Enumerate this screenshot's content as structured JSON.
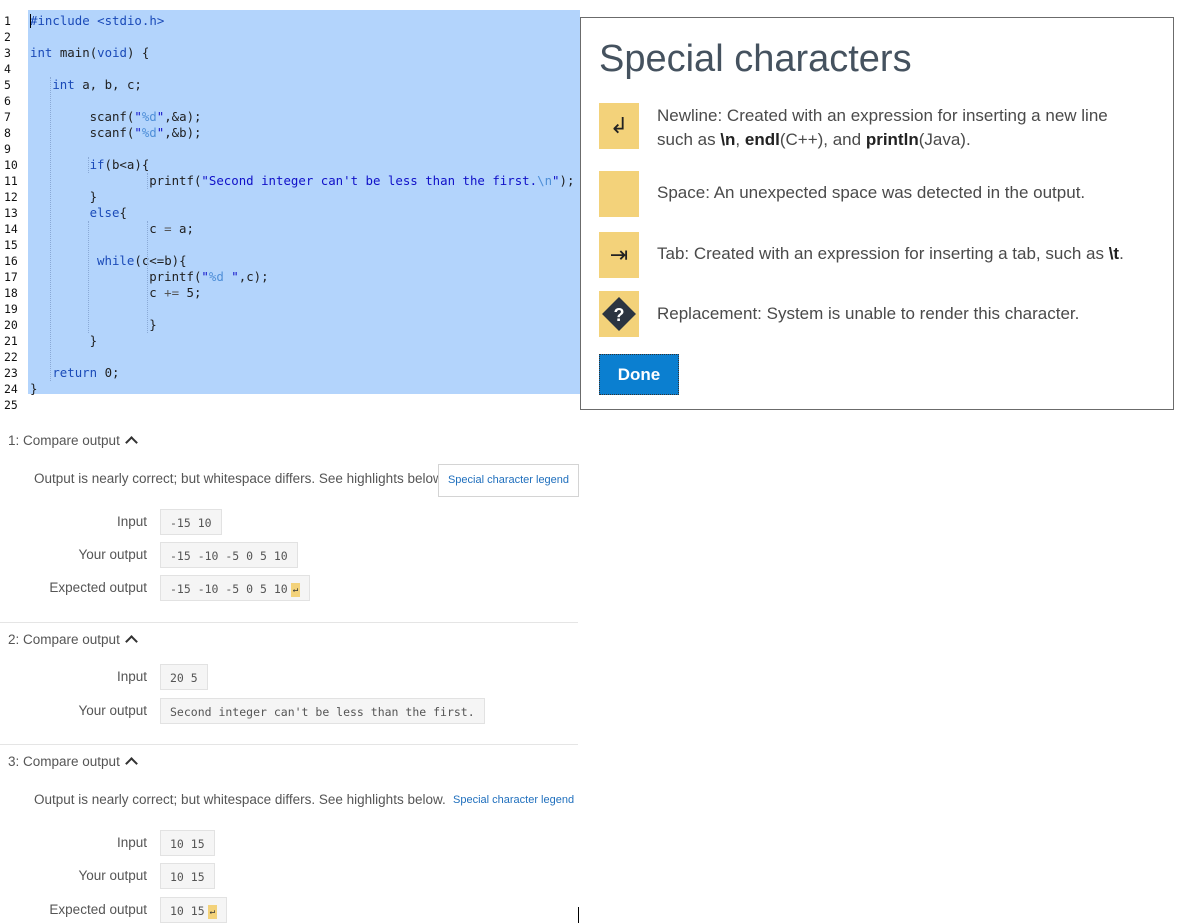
{
  "editor": {
    "line_numbers": [
      "1",
      "2",
      "3",
      "4",
      "5",
      "6",
      "7",
      "8",
      "9",
      "10",
      "11",
      "12",
      "13",
      "14",
      "15",
      "16",
      "17",
      "18",
      "19",
      "20",
      "21",
      "22",
      "23",
      "24",
      "25"
    ],
    "lines": [
      {
        "indent": 0,
        "parts": [
          {
            "t": "#include <stdio.h>",
            "c": "kw"
          }
        ]
      },
      {
        "indent": 0,
        "parts": []
      },
      {
        "indent": 0,
        "parts": [
          {
            "t": "int",
            "c": "kw"
          },
          {
            "t": " main(",
            "c": ""
          },
          {
            "t": "void",
            "c": "kw"
          },
          {
            "t": ") {",
            "c": ""
          }
        ]
      },
      {
        "indent": 0,
        "parts": []
      },
      {
        "indent": 3,
        "parts": [
          {
            "t": "int",
            "c": "kw"
          },
          {
            "t": " a, b, c;",
            "c": ""
          }
        ]
      },
      {
        "indent": 0,
        "parts": []
      },
      {
        "indent": 8,
        "parts": [
          {
            "t": "scanf(",
            "c": ""
          },
          {
            "t": "\"",
            "c": "str"
          },
          {
            "t": "%d",
            "c": "esc"
          },
          {
            "t": "\"",
            "c": "str"
          },
          {
            "t": ",&a);",
            "c": ""
          }
        ]
      },
      {
        "indent": 8,
        "parts": [
          {
            "t": "scanf(",
            "c": ""
          },
          {
            "t": "\"",
            "c": "str"
          },
          {
            "t": "%d",
            "c": "esc"
          },
          {
            "t": "\"",
            "c": "str"
          },
          {
            "t": ",&b);",
            "c": ""
          }
        ]
      },
      {
        "indent": 0,
        "parts": []
      },
      {
        "indent": 8,
        "parts": [
          {
            "t": "if",
            "c": "kw"
          },
          {
            "t": "(b<a){",
            "c": ""
          }
        ]
      },
      {
        "indent": 16,
        "parts": [
          {
            "t": "printf(",
            "c": ""
          },
          {
            "t": "\"Second integer can't be less than the first.",
            "c": "str"
          },
          {
            "t": "\\n",
            "c": "esc"
          },
          {
            "t": "\"",
            "c": "str"
          },
          {
            "t": ");",
            "c": ""
          }
        ]
      },
      {
        "indent": 8,
        "parts": [
          {
            "t": "}",
            "c": ""
          }
        ]
      },
      {
        "indent": 8,
        "parts": [
          {
            "t": "else",
            "c": "kw"
          },
          {
            "t": "{",
            "c": ""
          }
        ]
      },
      {
        "indent": 16,
        "parts": [
          {
            "t": "c ",
            "c": ""
          },
          {
            "t": "=",
            "c": "op"
          },
          {
            "t": " a;",
            "c": ""
          }
        ]
      },
      {
        "indent": 0,
        "parts": []
      },
      {
        "indent": 9,
        "parts": [
          {
            "t": "while",
            "c": "kw"
          },
          {
            "t": "(c<=b){",
            "c": ""
          }
        ]
      },
      {
        "indent": 16,
        "parts": [
          {
            "t": "printf(",
            "c": ""
          },
          {
            "t": "\"",
            "c": "str"
          },
          {
            "t": "%d ",
            "c": "esc"
          },
          {
            "t": "\"",
            "c": "str"
          },
          {
            "t": ",c);",
            "c": ""
          }
        ]
      },
      {
        "indent": 16,
        "parts": [
          {
            "t": "c ",
            "c": ""
          },
          {
            "t": "+=",
            "c": "op"
          },
          {
            "t": " 5;",
            "c": ""
          }
        ]
      },
      {
        "indent": 0,
        "parts": []
      },
      {
        "indent": 16,
        "parts": [
          {
            "t": "}",
            "c": ""
          }
        ]
      },
      {
        "indent": 8,
        "parts": [
          {
            "t": "}",
            "c": ""
          }
        ]
      },
      {
        "indent": 0,
        "parts": []
      },
      {
        "indent": 3,
        "parts": [
          {
            "t": "return",
            "c": "kw"
          },
          {
            "t": " 0;",
            "c": ""
          }
        ]
      },
      {
        "indent": 0,
        "parts": [
          {
            "t": "}",
            "c": ""
          }
        ]
      },
      {
        "indent": 0,
        "parts": []
      }
    ]
  },
  "results": {
    "sections": [
      {
        "title": "1: Compare output",
        "message": "Output is nearly correct; but whitespace differs. See highlights below.",
        "legend_label": "Special character legend",
        "rows": [
          {
            "label": "Input",
            "value": "-15 10",
            "newline": false
          },
          {
            "label": "Your output",
            "value": "-15 -10 -5 0 5 10",
            "newline": false
          },
          {
            "label": "Expected output",
            "value": "-15 -10 -5 0 5 10",
            "newline": true
          }
        ]
      },
      {
        "title": "2: Compare output",
        "rows": [
          {
            "label": "Input",
            "value": "20 5",
            "newline": false
          },
          {
            "label": "Your output",
            "value": "Second integer can't be less than the first.",
            "newline": false
          }
        ]
      },
      {
        "title": "3: Compare output",
        "message": "Output is nearly correct; but whitespace differs. See highlights below.",
        "legend_label": "Special character legend",
        "rows": [
          {
            "label": "Input",
            "value": "10 15",
            "newline": false
          },
          {
            "label": "Your output",
            "value": "10 15",
            "newline": false
          },
          {
            "label": "Expected output",
            "value": "10 15",
            "newline": true
          }
        ]
      }
    ],
    "newline_glyph": "↵"
  },
  "modal": {
    "title": "Special characters",
    "items": [
      {
        "icon": "newline-icon",
        "glyph": "↲",
        "text_html": "Newline: Created with an expression for inserting a new line such as <b>\\n</b>, <b>endl</b>(C++), and <b>println</b>(Java)."
      },
      {
        "icon": "space-icon",
        "glyph": "",
        "text_html": "Space: An unexpected space was detected in the output."
      },
      {
        "icon": "tab-icon",
        "glyph": "⇥",
        "text_html": "Tab: Created with an expression for inserting a tab, such as <b>\\t</b>."
      },
      {
        "icon": "replacement-character-icon",
        "glyph": "?",
        "text_html": "Replacement: System is unable to render this character."
      }
    ],
    "done_label": "Done"
  },
  "colors": {
    "selection": "#b3d4fc",
    "highlight": "#f3d27a",
    "accent": "#0b7fd0",
    "link": "#1f6fbd"
  }
}
